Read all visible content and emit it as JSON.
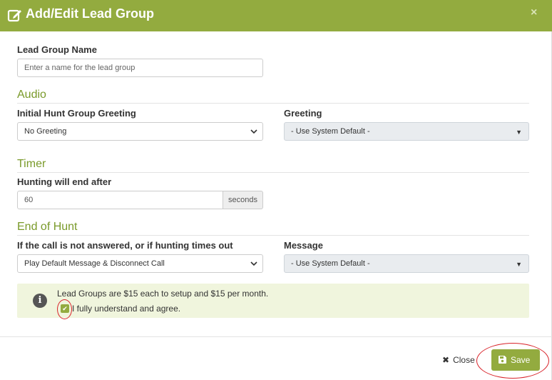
{
  "modal": {
    "title": "Add/Edit Lead Group",
    "close_symbol": "×",
    "header_color": "#93ab3f",
    "header_icon": "edit-icon"
  },
  "lead_group": {
    "label": "Lead Group Name",
    "placeholder": "Enter a name for the lead group"
  },
  "audio": {
    "section_title": "Audio",
    "greeting_label": "Initial Hunt Group Greeting",
    "greeting_value": "No Greeting",
    "system_greeting_label": "Greeting",
    "system_greeting_value": "- Use System Default -"
  },
  "timer": {
    "section_title": "Timer",
    "label": "Hunting will end after",
    "value": "60",
    "unit": "seconds"
  },
  "end_of_hunt": {
    "section_title": "End of Hunt",
    "action_label": "If the call is not answered, or if hunting times out",
    "action_value": "Play Default Message & Disconnect Call",
    "message_label": "Message",
    "message_value": "- Use System Default -"
  },
  "notice": {
    "text": "Lead Groups are $15 each to setup and $15 per month.",
    "agree_label": "I fully understand and agree.",
    "agree_checked": true,
    "background": "#f0f5dd"
  },
  "footer": {
    "close_label": "Close",
    "save_label": "Save",
    "accent_color": "#93ab3f",
    "highlight_color": "#d9242b"
  }
}
